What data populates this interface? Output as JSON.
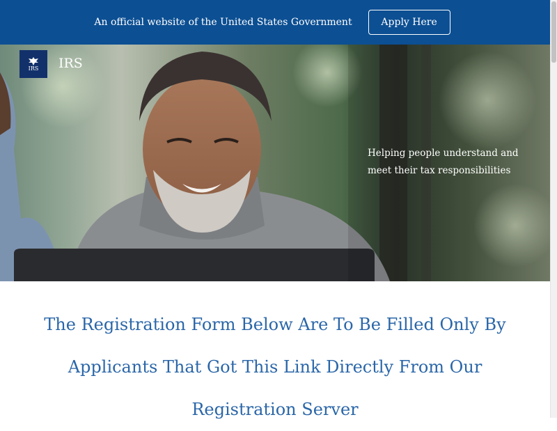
{
  "gov_banner": {
    "text": "An official website of the United States Government",
    "apply_button": "Apply Here"
  },
  "header": {
    "logo_text": "IRS",
    "brand_name": "IRS"
  },
  "hero": {
    "tagline_line1": "Helping people understand and",
    "tagline_line2": "meet their tax responsibilities"
  },
  "main": {
    "headline": "The Registration Form Below Are To Be Filled Only By Applicants That Got This Link Directly From Our Registration Server"
  },
  "colors": {
    "banner": "#0c4f93",
    "logo_bg": "#12316b",
    "headline": "#2a66a8"
  },
  "icons": {
    "logo": "irs-eagle-icon"
  }
}
